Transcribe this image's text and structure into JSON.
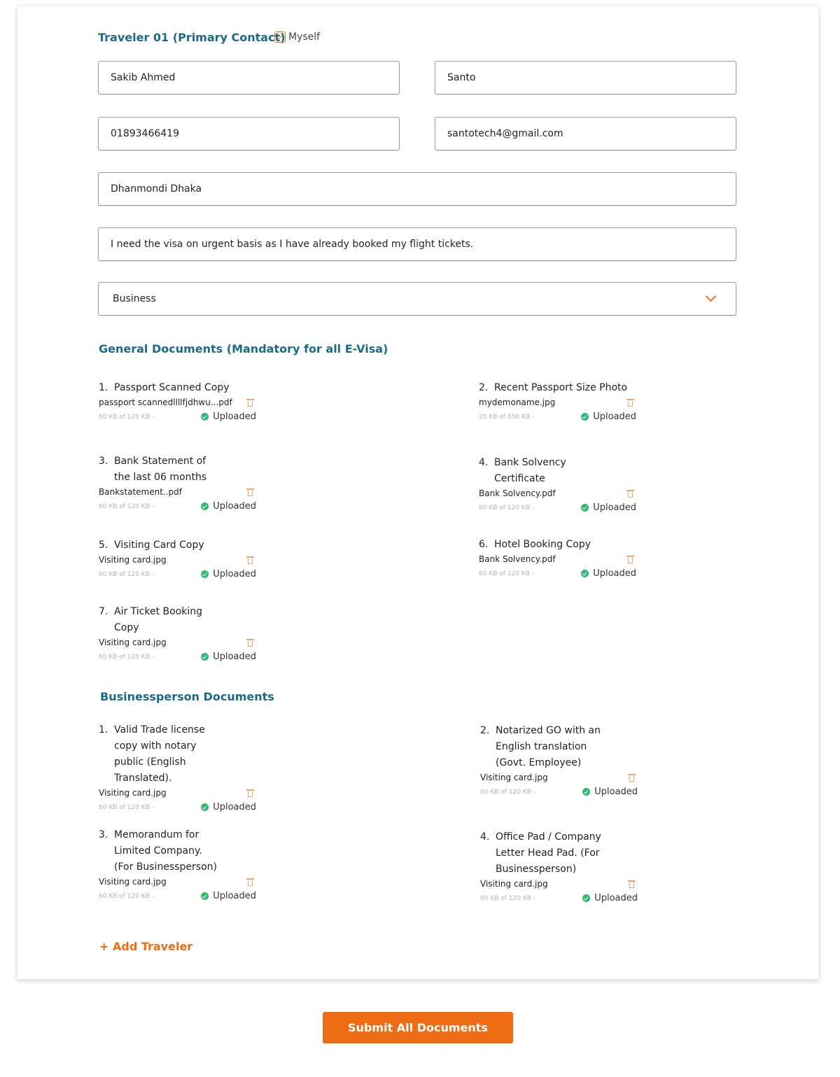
{
  "traveler": {
    "title": "Traveler 01 (Primary Contact)",
    "myself_label": "Myself"
  },
  "form": {
    "first_name": "Sakib Ahmed",
    "last_name": "Santo",
    "phone": "01893466419",
    "email": "santotech4@gmail.com",
    "address": "Dhanmondi Dhaka",
    "note": "I need the visa on urgent basis as I have already booked my flight tickets.",
    "visa_type": "Business"
  },
  "general_docs": {
    "title": "General Documents (Mandatory for all E-Visa)",
    "items": [
      {
        "num": "1.",
        "title": "Passport Scanned Copy",
        "file": "passport scannedllllfjdhwu...pdf",
        "size": "60 KB of 120 KB -",
        "status": "Uploaded"
      },
      {
        "num": "2.",
        "title": "Recent Passport Size Photo",
        "file": "mydemoname.jpg",
        "size": "20 KB of 850 KB -",
        "status": "Uploaded"
      },
      {
        "num": "3.",
        "title": "Bank Statement of\nthe last 06 months",
        "file": "Bankstatement..pdf",
        "size": "60 KB of 120 KB -",
        "status": "Uploaded"
      },
      {
        "num": "4.",
        "title": "Bank Solvency\nCertificate",
        "file": "Bank Solvency.pdf",
        "size": "60 KB of 120 KB -",
        "status": "Uploaded"
      },
      {
        "num": "5.",
        "title": "Visiting Card Copy",
        "file": "Visiting card.jpg",
        "size": "60 KB of 120 KB -",
        "status": "Uploaded"
      },
      {
        "num": "6.",
        "title": "Hotel Booking Copy",
        "file": "Bank Solvency.pdf",
        "size": "60 KB of 120 KB -",
        "status": "Uploaded"
      },
      {
        "num": "7.",
        "title": "Air Ticket Booking\nCopy",
        "file": "Visiting card.jpg",
        "size": "60 KB of 120 KB -",
        "status": "Uploaded"
      }
    ]
  },
  "business_docs": {
    "title": "Businessperson Documents",
    "items": [
      {
        "num": "1.",
        "title": "Valid Trade license\ncopy with notary\npublic (English\nTranslated).",
        "file": "Visiting card.jpg",
        "size": "60 KB of 120 KB -",
        "status": "Uploaded"
      },
      {
        "num": "2.",
        "title": "Notarized GO with an\nEnglish translation\n(Govt. Employee)",
        "file": "Visiting card.jpg",
        "size": "60 KB of 120 KB -",
        "status": "Uploaded"
      },
      {
        "num": "3.",
        "title": "Memorandum for\nLimited Company.\n(For Businessperson)",
        "file": "Visiting card.jpg",
        "size": "60 KB of 120 KB -",
        "status": "Uploaded"
      },
      {
        "num": "4.",
        "title": "Office Pad / Company\nLetter Head Pad. (For\nBusinessperson)",
        "file": "Visiting card.jpg",
        "size": "60 KB of 120 KB -",
        "status": "Uploaded"
      }
    ]
  },
  "add_traveler_label": "+ Add Traveler",
  "submit_label": "Submit All Documents",
  "colors": {
    "accent": "#ee6c13",
    "heading": "#1c6b86",
    "success": "#2eb872"
  }
}
